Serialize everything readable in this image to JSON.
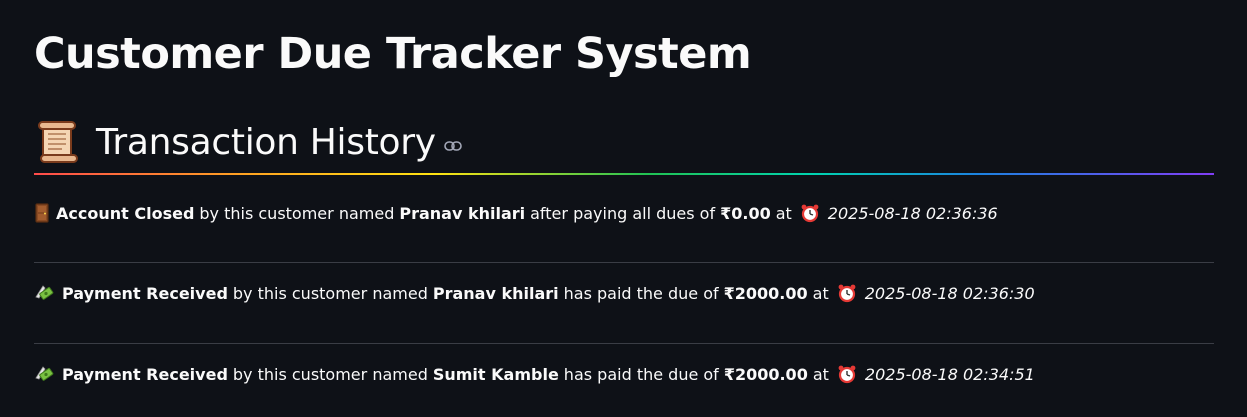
{
  "page": {
    "title": "Customer Due Tracker System"
  },
  "section": {
    "icon": "scroll-icon",
    "heading": "Transaction History",
    "anchor_icon": "link-icon"
  },
  "transactions": [
    {
      "icon": "door-icon",
      "event": "Account Closed",
      "text_before_name": "by this customer named",
      "customer": "Pranav khilari",
      "text_after_name": "after paying all dues of",
      "amount": "₹0.00",
      "at_text": "at",
      "clock_icon": "alarm-clock-icon",
      "timestamp": "2025-08-18 02:36:36"
    },
    {
      "icon": "money-with-wings-icon",
      "event": "Payment Received",
      "text_before_name": "by this customer named",
      "customer": "Pranav khilari",
      "text_after_name": "has paid the due of",
      "amount": "₹2000.00",
      "at_text": "at",
      "clock_icon": "alarm-clock-icon",
      "timestamp": "2025-08-18 02:36:30"
    },
    {
      "icon": "money-with-wings-icon",
      "event": "Payment Received",
      "text_before_name": "by this customer named",
      "customer": "Sumit Kamble",
      "text_after_name": "has paid the due of",
      "amount": "₹2000.00",
      "at_text": "at",
      "clock_icon": "alarm-clock-icon",
      "timestamp": "2025-08-18 02:34:51"
    }
  ],
  "colors": {
    "background": "#0e1117",
    "text": "#fafafa",
    "divider": "#3a3d45",
    "rainbow": [
      "#ff4b4b",
      "#ffa421",
      "#ffe312",
      "#21c354",
      "#00d4b1",
      "#1c83e1",
      "#803df5"
    ]
  }
}
